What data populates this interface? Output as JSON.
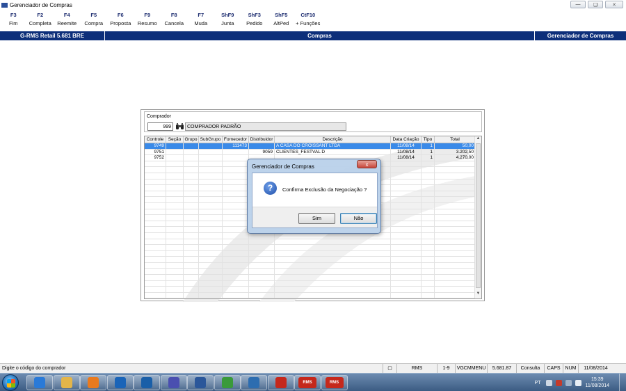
{
  "window": {
    "title": "Gerenciador de Compras"
  },
  "fkeys": [
    {
      "key": "F3",
      "label": "Fim"
    },
    {
      "key": "F2",
      "label": "Completa"
    },
    {
      "key": "F4",
      "label": "Reemite"
    },
    {
      "key": "F5",
      "label": "Compra"
    },
    {
      "key": "F6",
      "label": "Proposta"
    },
    {
      "key": "F9",
      "label": "Resumo"
    },
    {
      "key": "F8",
      "label": "Cancela"
    },
    {
      "key": "F7",
      "label": "Muda"
    },
    {
      "key": "ShF9",
      "label": "Junta"
    },
    {
      "key": "ShF3",
      "label": "Pedido"
    },
    {
      "key": "ShF5",
      "label": "AltPed"
    },
    {
      "key": "CtF10",
      "label": "+ Funções"
    }
  ],
  "header": {
    "left": "G-RMS Retail 5.681 BRE",
    "center": "Compras",
    "right": "Gerenciador de Compras"
  },
  "buyer": {
    "label": "Comprador",
    "code": "999",
    "name": "COMPRADOR PADRÃO"
  },
  "grid": {
    "columns": [
      "Controle",
      "Seção",
      "Grupo",
      "SubGrupo",
      "Fornecedor",
      "Distribuidor",
      "Descrição",
      "Data Criação",
      "Tipo",
      "Total"
    ],
    "rows": [
      {
        "controle": "9749",
        "secao": "",
        "grupo": "",
        "subgrupo": "",
        "fornecedor": "111473",
        "distribuidor": "",
        "descricao": "A CASA DO CROISSANT LTDA",
        "data": "11/08/14",
        "tipo": "1",
        "total": "50,00",
        "selected": true
      },
      {
        "controle": "9751",
        "secao": "",
        "grupo": "",
        "subgrupo": "",
        "fornecedor": "",
        "distribuidor": "9059",
        "descricao": "CLIENTES_FESTVAL D",
        "data": "11/08/14",
        "tipo": "1",
        "total": "3.202,50",
        "selected": false
      },
      {
        "controle": "9752",
        "secao": "",
        "grupo": "",
        "subgrupo": "",
        "fornecedor": "",
        "distribuidor": "",
        "descricao": "",
        "data": "11/08/14",
        "tipo": "1",
        "total": "4.270,00",
        "selected": false
      }
    ]
  },
  "dialog": {
    "title": "Gerenciador de Compras",
    "message": "Confirma Exclusão da Negociação ?",
    "yes": "Sim",
    "no": "Não",
    "close": "x"
  },
  "statusbar": {
    "message": "Digite o código do comprador",
    "cells": [
      "RMS",
      "1-9",
      "VGCMMENU",
      "5.681.87",
      "Consulta",
      "CAPS",
      "NUM",
      "11/08/2014"
    ]
  },
  "taskbar": {
    "lang": "PT",
    "time": "15:39",
    "date": "11/08/2014",
    "apps": [
      "ie-icon",
      "explorer-icon",
      "media-player-icon",
      "outlook-icon",
      "lync-icon",
      "link-icon",
      "word-icon",
      "installer-icon",
      "remote-icon",
      "acrobat-icon",
      "rms-icon",
      "rms-icon"
    ],
    "rms_label": "RMS"
  }
}
